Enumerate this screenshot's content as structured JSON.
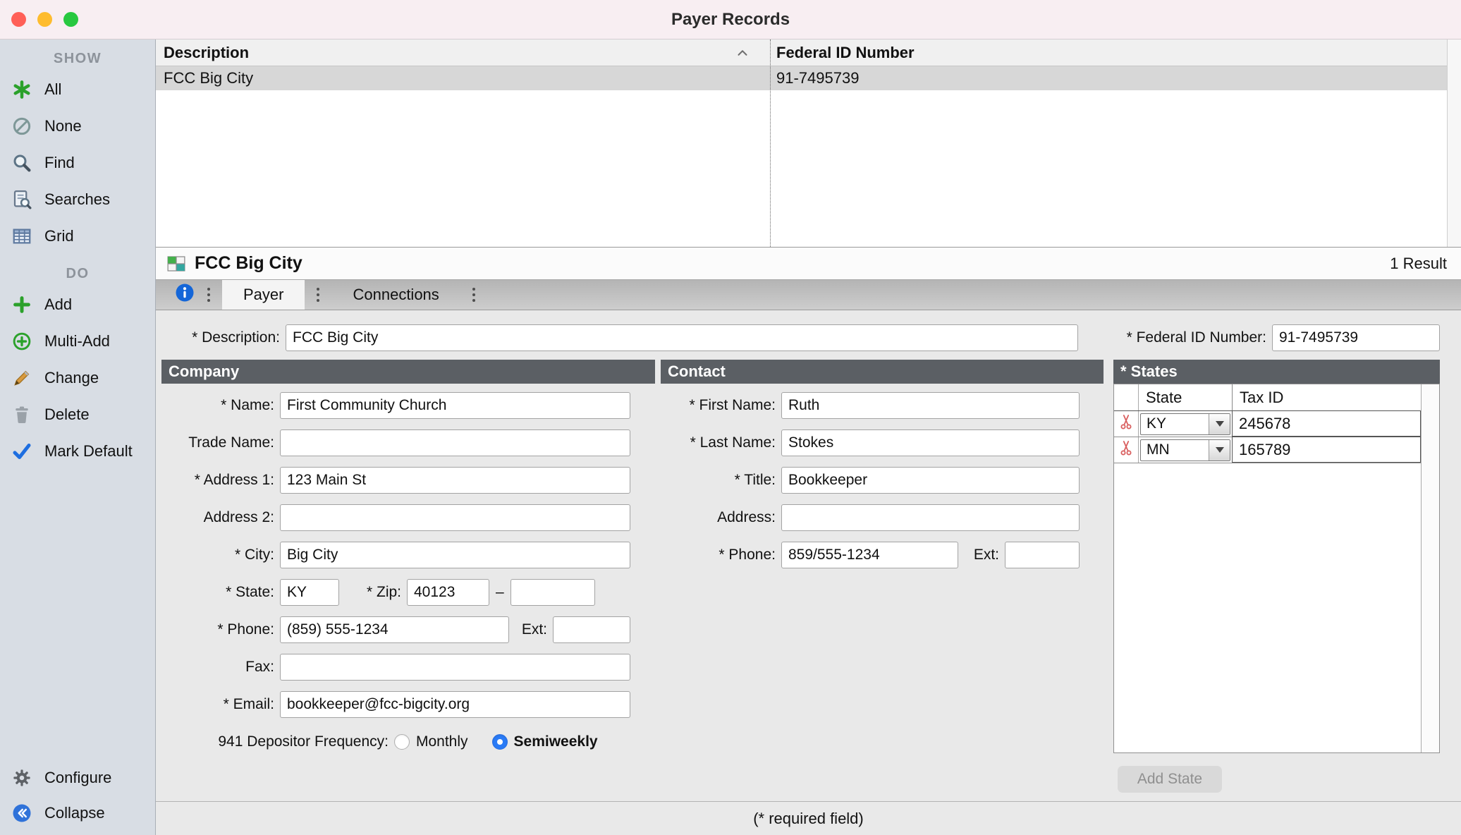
{
  "window": {
    "title": "Payer Records"
  },
  "colors": {
    "accent_blue": "#1e6ee0",
    "radio_selected": "#2a7bf6",
    "section_header_bg": "#5b5f64",
    "add_green": "#2ba12b",
    "delete_red": "#d95f5f",
    "selected_row_bg": "#d7d7d7"
  },
  "sidebar": {
    "sections": [
      {
        "header": "SHOW",
        "items": [
          {
            "label": "All",
            "icon": "asterisk-icon"
          },
          {
            "label": "None",
            "icon": "slash-circle-icon"
          },
          {
            "label": "Find",
            "icon": "magnifier-icon"
          },
          {
            "label": "Searches",
            "icon": "saved-searches-icon"
          },
          {
            "label": "Grid",
            "icon": "grid-icon"
          }
        ]
      },
      {
        "header": "DO",
        "items": [
          {
            "label": "Add",
            "icon": "plus-icon"
          },
          {
            "label": "Multi-Add",
            "icon": "circle-plus-icon"
          },
          {
            "label": "Change",
            "icon": "pencil-icon"
          },
          {
            "label": "Delete",
            "icon": "trash-icon"
          },
          {
            "label": "Mark Default",
            "icon": "check-icon"
          }
        ]
      }
    ],
    "footer_items": [
      {
        "label": "Configure",
        "icon": "gear-icon"
      },
      {
        "label": "Collapse",
        "icon": "collapse-icon"
      }
    ]
  },
  "list": {
    "columns": [
      {
        "label": "Description",
        "sort": "asc"
      },
      {
        "label": "Federal ID Number",
        "sort": ""
      }
    ],
    "rows": [
      {
        "description": "FCC Big City",
        "federal_id": "91-7495739",
        "selected": true
      }
    ]
  },
  "record": {
    "title": "FCC Big City",
    "results": "1 Result"
  },
  "tabs": [
    {
      "label": "Payer",
      "selected": true
    },
    {
      "label": "Connections",
      "selected": false
    }
  ],
  "form": {
    "description_label": "* Description:",
    "description_value": "FCC Big City",
    "federal_id_label": "* Federal ID Number:",
    "federal_id_value": "91-7495739",
    "company": {
      "header": "Company",
      "name_label": "* Name:",
      "name_value": "First Community Church",
      "trade_name_label": "Trade Name:",
      "trade_name_value": "",
      "address1_label": "* Address 1:",
      "address1_value": "123 Main St",
      "address2_label": "Address 2:",
      "address2_value": "",
      "city_label": "* City:",
      "city_value": "Big City",
      "state_label": "* State:",
      "state_value": "KY",
      "zip_label": "* Zip:",
      "zip_value": "40123",
      "zip_separator": "–",
      "zip4_value": "",
      "phone_label": "* Phone:",
      "phone_value": "(859) 555-1234",
      "ext_label": "Ext:",
      "ext_value": "",
      "fax_label": "Fax:",
      "fax_value": "",
      "email_label": "* Email:",
      "email_value": "bookkeeper@fcc-bigcity.org",
      "frequency_label": "941 Depositor Frequency:",
      "frequency_options": [
        {
          "label": "Monthly",
          "selected": false
        },
        {
          "label": "Semiweekly",
          "selected": true
        }
      ]
    },
    "contact": {
      "header": "Contact",
      "first_name_label": "* First Name:",
      "first_name_value": "Ruth",
      "last_name_label": "* Last Name:",
      "last_name_value": "Stokes",
      "title_label": "* Title:",
      "title_value": "Bookkeeper",
      "address_label": "Address:",
      "address_value": "",
      "phone_label": "* Phone:",
      "phone_value": "859/555-1234",
      "ext_label": "Ext:",
      "ext_value": ""
    },
    "states": {
      "header": "* States",
      "columns": [
        "State",
        "Tax ID"
      ],
      "rows": [
        {
          "state": "KY",
          "tax_id": "245678"
        },
        {
          "state": "MN",
          "tax_id": "165789"
        }
      ],
      "add_button": "Add State"
    },
    "required_note": "(* required field)"
  }
}
